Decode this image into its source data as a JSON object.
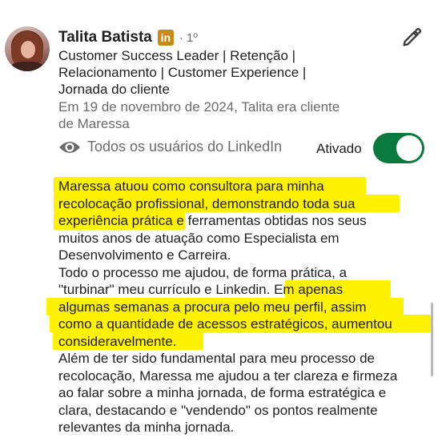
{
  "profile": {
    "name": "Talita Batista",
    "badge": "in",
    "degree": "· 1º",
    "headline_lines": [
      "Customer Success Leader | Retenção |",
      "Relacionamento | Customer Experience |",
      "Jornada do cliente"
    ],
    "context_lines": [
      "Em 19 de novembro de 2024, Talita era cliente",
      "de Maressa"
    ]
  },
  "visibility": {
    "icon": "eye-icon",
    "label": "Todos os usuários do LinkedIn",
    "toggle_label": "Ativado",
    "toggle_on": true
  },
  "actions": {
    "edit_icon": "pencil-icon"
  },
  "recommendation": {
    "lines": [
      "Maressa atuou como consultora para minha",
      "recolocação profissional, demonstrando toda sua",
      "experiência prática e ferramentas obtidas nos seus",
      "muitos anos de atuação como Especialista em",
      "Desenvolvimento e Carreira.",
      "Todo o processo me ajudou, de forma prática, a",
      "\"turbinar\" meu currículo e Linkedin. Em apenas",
      "algumas semanas a procura pelo meu perfil, assim",
      "como a quantidade de acessos estratégicos, aumentou",
      "consideravelmente.",
      "Além de ter sido fundamental para meu processo de",
      "recolocação, Maressa me ajudou a ter clareza e firmeza",
      "ao falar sobre a minha jornada, de forma estratégica e",
      "clara, destacando e \"vendendo\" os pontos realmente",
      "relevantes da minha jornada."
    ]
  },
  "colors": {
    "highlight": "#fff200",
    "toggle_on": "#0a7a3c",
    "badge": "#c98a1c"
  }
}
